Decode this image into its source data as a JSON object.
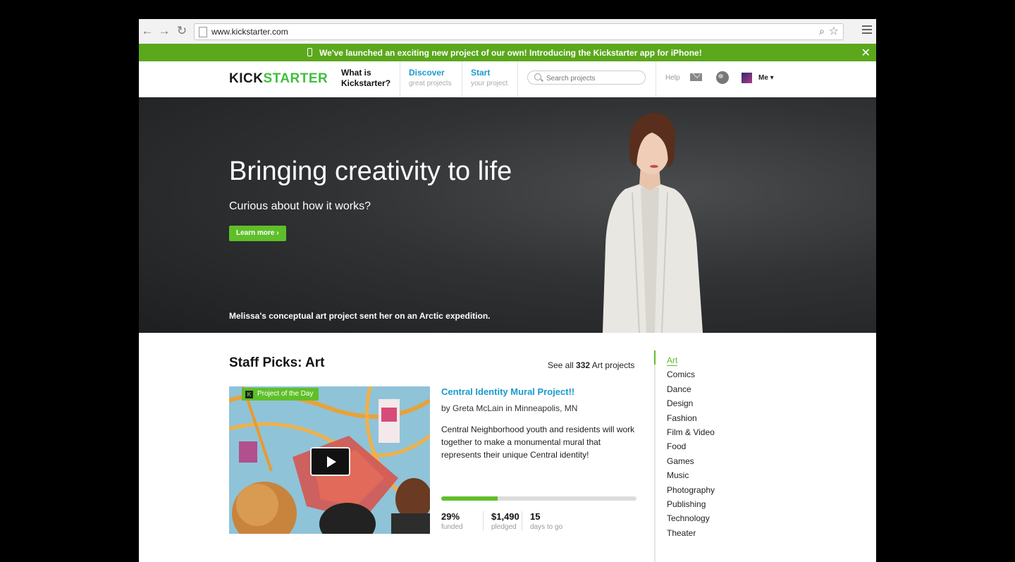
{
  "browser": {
    "url": "www.kickstarter.com"
  },
  "banner": {
    "message": "We've launched an exciting new project of our own! Introducing the Kickstarter app for iPhone!",
    "close": "✕"
  },
  "header": {
    "logo_part1": "KICK",
    "logo_part2": "STARTER",
    "nav": {
      "what_line1": "What is",
      "what_line2": "Kickstarter?",
      "discover": "Discover",
      "discover_sub": "great projects",
      "start": "Start",
      "start_sub": "your project"
    },
    "search_placeholder": "Search projects",
    "help": "Help",
    "me": "Me ▾"
  },
  "hero": {
    "title": "Bringing creativity to life",
    "subtitle": "Curious about how it works?",
    "button": "Learn more ›",
    "caption": "Melissa's conceptual art project sent her on an Arctic expedition."
  },
  "staff_picks": {
    "title": "Staff Picks: Art",
    "see_all_prefix": "See all",
    "see_all_count": "332",
    "see_all_suffix": "Art projects",
    "badge": "Project of the Day",
    "badge_letter": "K",
    "project": {
      "title": "Central Identity Mural Project!!",
      "byline": "by Greta McLain in Minneapolis, MN",
      "blurb": "Central Neighborhood youth and residents will work together to make a monumental mural that represents their unique Central identity!",
      "funded_fraction": 0.29,
      "stats": [
        {
          "value": "29%",
          "label": "funded"
        },
        {
          "value": "$1,490",
          "label": "pledged"
        },
        {
          "value": "15",
          "label": "days to go"
        }
      ]
    }
  },
  "categories": [
    "Art",
    "Comics",
    "Dance",
    "Design",
    "Fashion",
    "Film & Video",
    "Food",
    "Games",
    "Music",
    "Photography",
    "Publishing",
    "Technology",
    "Theater"
  ],
  "colors": {
    "brand_green": "#5fbf2a",
    "link_blue": "#1a9acc",
    "banner_green": "#5ba81c"
  }
}
